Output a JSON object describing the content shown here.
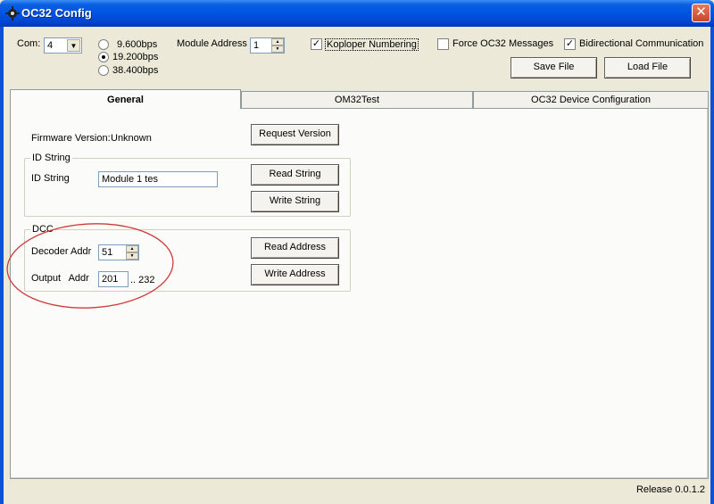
{
  "window": {
    "title": "OC32 Config",
    "close_glyph": "✕"
  },
  "top": {
    "com_label": "Com:",
    "com_value": "4",
    "baud_options": [
      {
        "label": "9.600bps",
        "checked": false
      },
      {
        "label": "19.200bps",
        "checked": true
      },
      {
        "label": "38.400bps",
        "checked": false
      }
    ],
    "module_address_label": "Module Address",
    "module_address_value": "1",
    "kop_loper_label": "Koploper Numbering",
    "kop_loper_checked": true,
    "force_oc32_label": "Force OC32 Messages",
    "force_oc32_checked": false,
    "bidir_label": "Bidirectional Communication",
    "bidir_checked": true,
    "save_file_label": "Save File",
    "load_file_label": "Load File"
  },
  "tabs": [
    {
      "label": "General",
      "active": true
    },
    {
      "label": "OM32Test",
      "active": false
    },
    {
      "label": "OC32 Device Configuration",
      "active": false
    }
  ],
  "general": {
    "firmware_label": "Firmware Version:",
    "firmware_value": "Unknown",
    "request_version_label": "Request Version",
    "id_group_title": "ID String",
    "id_label": "ID String",
    "id_value": "Module 1 tes",
    "read_string_label": "Read String",
    "write_string_label": "Write String",
    "dcc_group_title": "DCC",
    "decoder_addr_label": "Decoder Addr",
    "decoder_addr_value": "51",
    "output_addr_label": "Output   Addr",
    "output_addr_value": "201",
    "output_addr_range": ".. 232",
    "read_address_label": "Read Address",
    "write_address_label": "Write Address"
  },
  "status": {
    "release": "Release 0.0.1.2"
  },
  "colors": {
    "titlebar": "#0054e3",
    "face": "#ece9d8",
    "annotation": "#d03a3a"
  }
}
